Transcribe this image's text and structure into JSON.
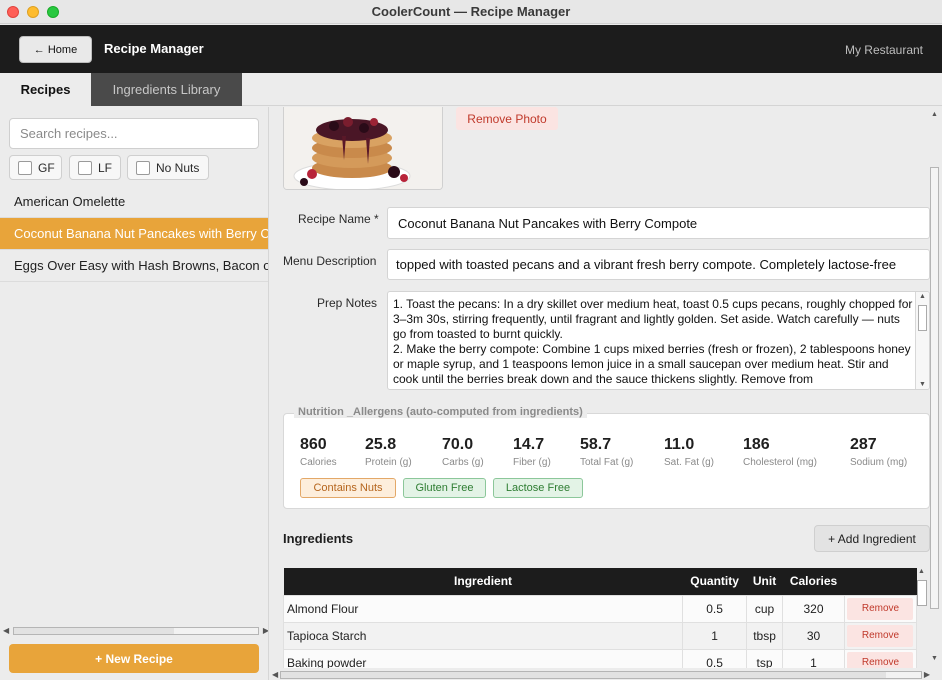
{
  "window": {
    "title": "CoolerCount — Recipe Manager"
  },
  "header": {
    "home_label": "← Home",
    "app_title": "Recipe Manager",
    "restaurant": "My Restaurant"
  },
  "tabs": [
    {
      "label": "Recipes",
      "active": true
    },
    {
      "label": "Ingredients Library",
      "active": false
    }
  ],
  "sidebar": {
    "search_placeholder": "Search recipes...",
    "filters": [
      {
        "label": "GF",
        "checked": false
      },
      {
        "label": "LF",
        "checked": false
      },
      {
        "label": "No Nuts",
        "checked": false
      }
    ],
    "recipes": [
      {
        "label": "American Omelette",
        "selected": false
      },
      {
        "label": "Coconut Banana Nut Pancakes with Berry Compote",
        "selected": true
      },
      {
        "label": "Eggs Over Easy with Hash Browns, Bacon or Sausage",
        "selected": false
      }
    ],
    "new_recipe_label": "+ New Recipe"
  },
  "form": {
    "remove_photo_label": "Remove Photo",
    "recipe_name_label": "Recipe Name *",
    "recipe_name_value": "Coconut Banana Nut Pancakes with Berry Compote",
    "menu_description_label": "Menu Description",
    "menu_description_value": "topped with toasted pecans and a vibrant fresh berry compote. Completely lactose-free",
    "prep_notes_label": "Prep Notes",
    "prep_notes_value": "1. Toast the pecans: In a dry skillet over medium heat, toast 0.5 cups pecans, roughly chopped for 3–3m 30s, stirring frequently, until fragrant and lightly golden. Set aside. Watch carefully — nuts go from toasted to burnt quickly.\n2. Make the berry compote: Combine 1 cups mixed berries (fresh or frozen), 2 tablespoons honey or maple syrup, and 1 teaspoons lemon juice in a small saucepan over medium heat. Stir and cook until the berries break down and the sauce thickens slightly. Remove from"
  },
  "nutrition": {
    "title": "Nutrition _Allergens  (auto-computed from ingredients)",
    "values": [
      {
        "value": "860",
        "label": "Calories"
      },
      {
        "value": "25.8",
        "label": "Protein (g)"
      },
      {
        "value": "70.0",
        "label": "Carbs (g)"
      },
      {
        "value": "14.7",
        "label": "Fiber (g)"
      },
      {
        "value": "58.7",
        "label": "Total Fat (g)"
      },
      {
        "value": "11.0",
        "label": "Sat. Fat (g)"
      },
      {
        "value": "186",
        "label": "Cholesterol (mg)"
      },
      {
        "value": "287",
        "label": "Sodium (mg)"
      }
    ],
    "badges": [
      "Contains Nuts",
      "Gluten Free",
      "Lactose Free"
    ]
  },
  "ingredients": {
    "title": "Ingredients",
    "add_label": "+ Add Ingredient",
    "columns": [
      "Ingredient",
      "Quantity",
      "Unit",
      "Calories",
      ""
    ],
    "remove_label": "Remove",
    "rows": [
      {
        "name": "Almond Flour",
        "quantity": "0.5",
        "unit": "cup",
        "calories": "320"
      },
      {
        "name": "Tapioca Starch",
        "quantity": "1",
        "unit": "tbsp",
        "calories": "30"
      },
      {
        "name": "Baking powder",
        "quantity": "0.5",
        "unit": "tsp",
        "calories": "1"
      }
    ]
  },
  "colors": {
    "accent": "#e8a43a",
    "header": "#1c1c1c",
    "danger": "#c0392b",
    "success": "#2e7d32"
  }
}
